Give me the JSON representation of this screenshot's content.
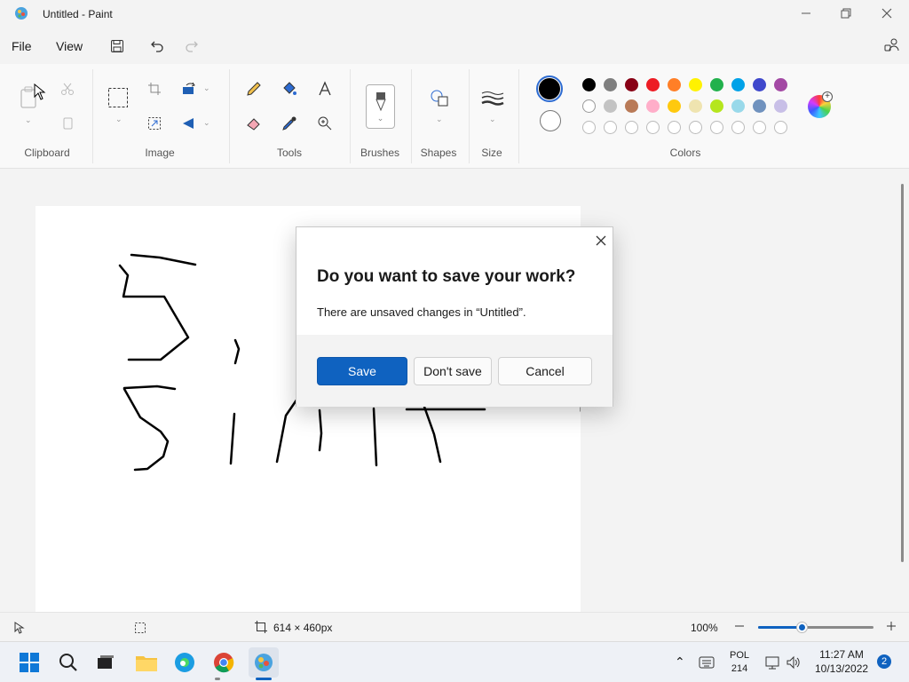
{
  "window": {
    "title": "Untitled - Paint"
  },
  "menu": {
    "file": "File",
    "view": "View"
  },
  "ribbon": {
    "groups": {
      "clipboard": "Clipboard",
      "image": "Image",
      "tools": "Tools",
      "brushes": "Brushes",
      "shapes": "Shapes",
      "size": "Size",
      "colors": "Colors"
    }
  },
  "palette": {
    "row1": [
      "#000000",
      "#7f7f7f",
      "#880015",
      "#ed1c24",
      "#ff7f27",
      "#fff200",
      "#22b14c",
      "#00a2e8",
      "#3f48cc",
      "#a349a4"
    ],
    "row2": [
      "#ffffff",
      "#c3c3c3",
      "#b97a57",
      "#ffaec9",
      "#ffc90e",
      "#efe4b0",
      "#b5e61d",
      "#99d9ea",
      "#7092be",
      "#c8bfe7"
    ],
    "primary": "#000000",
    "secondary": "#ffffff"
  },
  "status": {
    "canvas_size": "614 × 460px",
    "zoom": "100%"
  },
  "dialog": {
    "title": "Do you want to save your work?",
    "message": "There are unsaved changes in “Untitled”.",
    "save": "Save",
    "dont_save": "Don't save",
    "cancel": "Cancel"
  },
  "taskbar": {
    "lang": "POL",
    "lang_code": "214",
    "time": "11:27 AM",
    "date": "10/13/2022",
    "notifications": "2"
  },
  "colors": {
    "accent": "#0f62c0"
  }
}
